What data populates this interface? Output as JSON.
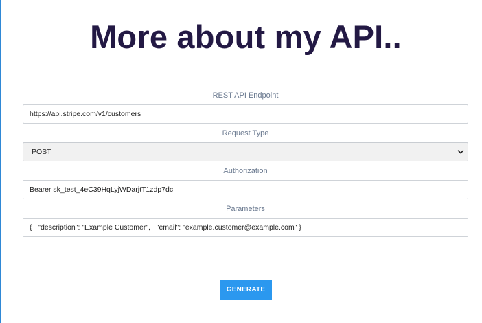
{
  "page": {
    "title": "More about my API.."
  },
  "form": {
    "endpoint": {
      "label": "REST API Endpoint",
      "value": "https://api.stripe.com/v1/customers"
    },
    "request_type": {
      "label": "Request Type",
      "selected": "POST"
    },
    "authorization": {
      "label": "Authorization",
      "value": "Bearer sk_test_4eC39HqLyjWDarjtT1zdp7dc"
    },
    "parameters": {
      "label": "Parameters",
      "value": "{   \"description\": \"Example Customer\",   \"email\": \"example.customer@example.com\" }"
    }
  },
  "actions": {
    "generate_label": "GENERATE"
  },
  "colors": {
    "heading": "#231944",
    "label": "#6b7a90",
    "button": "#2b98ef",
    "left_edge": "#2f88d6"
  },
  "icons": {
    "select_arrow": "chevron-down-icon"
  }
}
